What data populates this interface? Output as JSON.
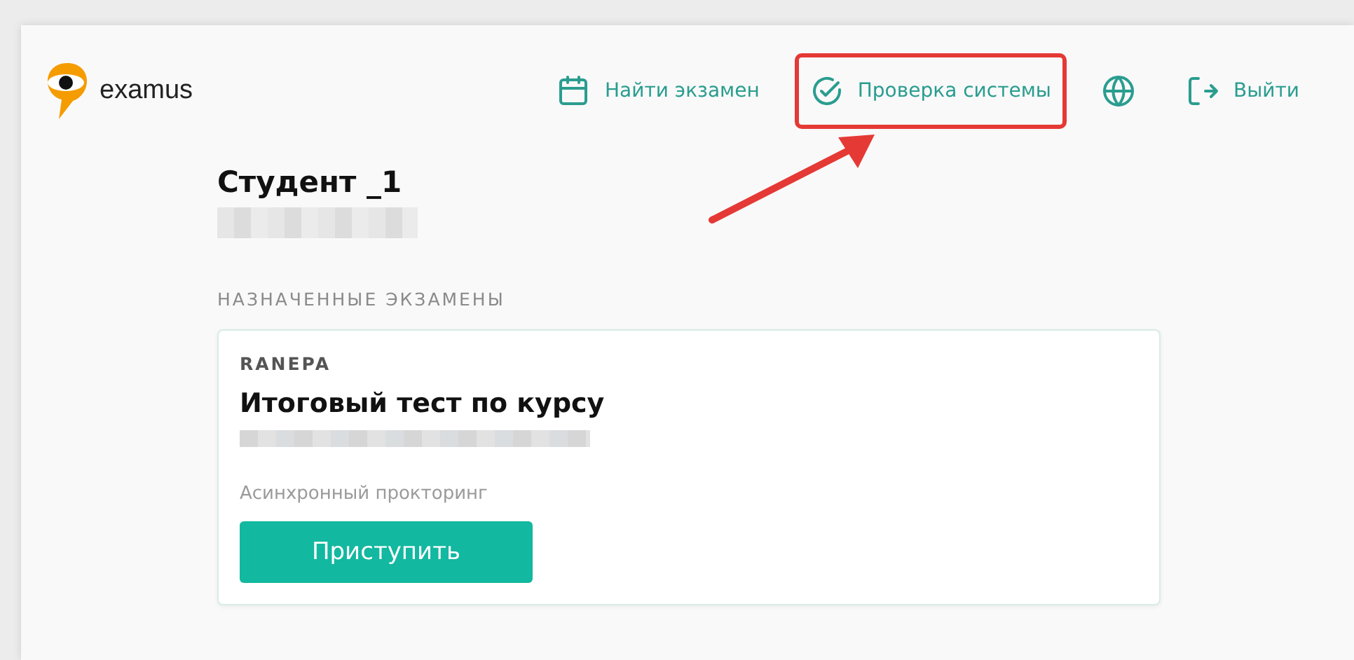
{
  "header": {
    "logo_text": "examus",
    "nav": [
      {
        "kind": "calendar",
        "label": "Найти экзамен",
        "highlighted": false
      },
      {
        "kind": "check",
        "label": "Проверка системы",
        "highlighted": true
      },
      {
        "kind": "globe",
        "highlighted": false
      },
      {
        "kind": "exit",
        "label": "Выйти",
        "highlighted": false
      }
    ]
  },
  "profile": {
    "name": "Студент _1"
  },
  "section_title": "НАЗНАЧЕННЫЕ ЭКЗАМЕНЫ",
  "exams": [
    {
      "organization": "RANEPA",
      "title": "Итоговый тест по курсу",
      "type": "Асинхронный прокторинг",
      "button": "Приступить"
    }
  ]
}
